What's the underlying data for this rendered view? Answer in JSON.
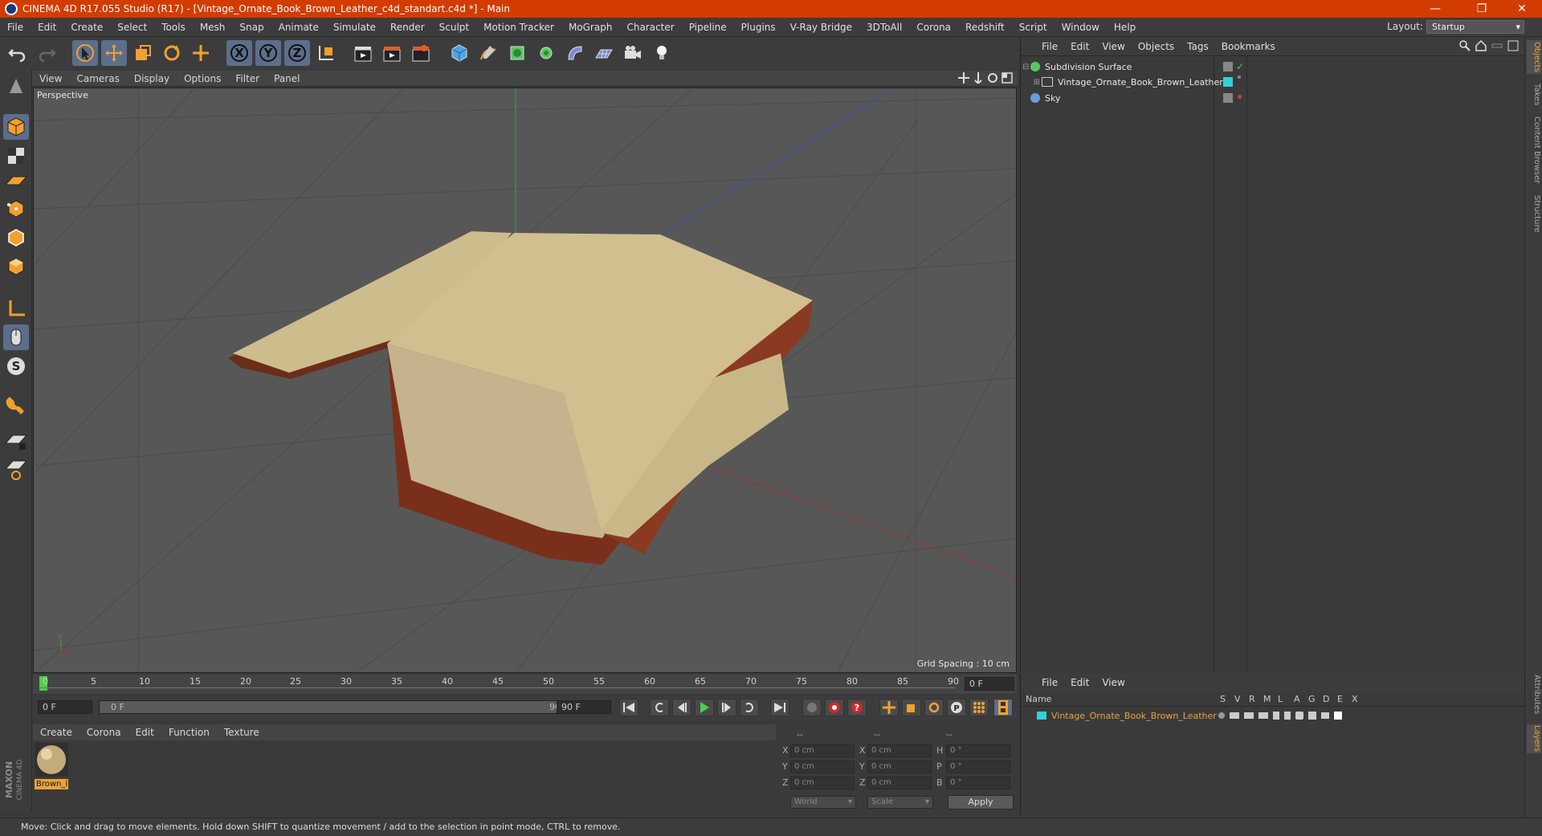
{
  "window": {
    "title": "CINEMA 4D R17.055 Studio (R17) - [Vintage_Ornate_Book_Brown_Leather_c4d_standart.c4d *] - Main",
    "minimize": "—",
    "restore": "❐",
    "close": "✕"
  },
  "menu": [
    "File",
    "Edit",
    "Create",
    "Select",
    "Tools",
    "Mesh",
    "Snap",
    "Animate",
    "Simulate",
    "Render",
    "Sculpt",
    "Motion Tracker",
    "MoGraph",
    "Character",
    "Pipeline",
    "Plugins",
    "V-Ray Bridge",
    "3DToAll",
    "Corona",
    "Redshift",
    "Script",
    "Window",
    "Help"
  ],
  "layout": {
    "label": "Layout:",
    "value": "Startup"
  },
  "viewport": {
    "menu": [
      "View",
      "Cameras",
      "Display",
      "Options",
      "Filter",
      "Panel"
    ],
    "label": "Perspective",
    "grid_spacing": "Grid Spacing : 10 cm"
  },
  "timeline": {
    "ticks": [
      "0",
      "5",
      "10",
      "15",
      "20",
      "25",
      "30",
      "35",
      "40",
      "45",
      "50",
      "55",
      "60",
      "65",
      "70",
      "75",
      "80",
      "85",
      "90"
    ],
    "frame_field": "0 F",
    "start_field": "0 F",
    "range_start": "0 F",
    "range_end": "90 F",
    "end_field": "90 F"
  },
  "materials": {
    "menu": [
      "Create",
      "Corona",
      "Edit",
      "Function",
      "Texture"
    ],
    "items": [
      {
        "label": "Brown_l"
      }
    ]
  },
  "coords": {
    "headers": [
      "--",
      "--",
      "--"
    ],
    "rows": [
      {
        "a": "X",
        "av": "0 cm",
        "b": "X",
        "bv": "0 cm",
        "c": "H",
        "cv": "0 °"
      },
      {
        "a": "Y",
        "av": "0 cm",
        "b": "Y",
        "bv": "0 cm",
        "c": "P",
        "cv": "0 °"
      },
      {
        "a": "Z",
        "av": "0 cm",
        "b": "Z",
        "bv": "0 cm",
        "c": "B",
        "cv": "0 °"
      }
    ],
    "space": "World",
    "mode": "Scale",
    "apply": "Apply"
  },
  "objects": {
    "menu": [
      "File",
      "Edit",
      "View",
      "Objects",
      "Tags",
      "Bookmarks"
    ],
    "items": [
      {
        "name": "Subdivision Surface",
        "color": "#59c860"
      },
      {
        "name": "Vintage_Ornate_Book_Brown_Leather",
        "color": "#d0d0d0"
      },
      {
        "name": "Sky",
        "color": "#6c9bd8"
      }
    ]
  },
  "layers": {
    "menu": [
      "File",
      "Edit",
      "View"
    ],
    "columns": [
      "Name",
      "S",
      "V",
      "R",
      "M",
      "L",
      "A",
      "G",
      "D",
      "E",
      "X"
    ],
    "items": [
      {
        "name": "Vintage_Ornate_Book_Brown_Leather"
      }
    ]
  },
  "right_tabs": [
    "Objects",
    "Takes",
    "Content Browser",
    "Structure",
    "Attributes",
    "Layers"
  ],
  "brand": "MAXON CINEMA 4D",
  "status": "Move: Click and drag to move elements. Hold down SHIFT to quantize movement / add to the selection in point mode, CTRL to remove."
}
